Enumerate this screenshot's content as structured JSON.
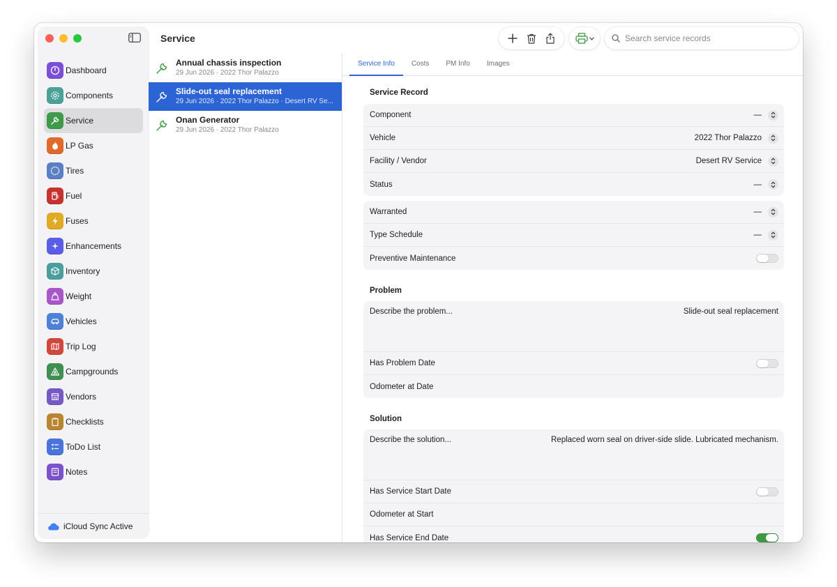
{
  "window": {
    "title": "Service"
  },
  "sidebar": {
    "items": [
      {
        "label": "Dashboard",
        "icon": "gauge-icon",
        "color": "#7b4fd6"
      },
      {
        "label": "Components",
        "icon": "gear-icon",
        "color": "#4aa198"
      },
      {
        "label": "Service",
        "icon": "wrench-icon",
        "color": "#3f9b4a"
      },
      {
        "label": "LP Gas",
        "icon": "flame-icon",
        "color": "#e0692c"
      },
      {
        "label": "Tires",
        "icon": "tire-icon",
        "color": "#5a7fc4"
      },
      {
        "label": "Fuel",
        "icon": "fuel-pump-icon",
        "color": "#c6322e"
      },
      {
        "label": "Fuses",
        "icon": "bolt-icon",
        "color": "#e1aa23"
      },
      {
        "label": "Enhancements",
        "icon": "sparkles-icon",
        "color": "#5a5ee6"
      },
      {
        "label": "Inventory",
        "icon": "box-icon",
        "color": "#4a9f9e"
      },
      {
        "label": "Weight",
        "icon": "scale-icon",
        "color": "#a956c9"
      },
      {
        "label": "Vehicles",
        "icon": "car-icon",
        "color": "#4e80d8"
      },
      {
        "label": "Trip Log",
        "icon": "map-icon",
        "color": "#d2473d"
      },
      {
        "label": "Campgrounds",
        "icon": "tent-icon",
        "color": "#3f9050"
      },
      {
        "label": "Vendors",
        "icon": "storefront-icon",
        "color": "#7658c7"
      },
      {
        "label": "Checklists",
        "icon": "clipboard-icon",
        "color": "#b9862f"
      },
      {
        "label": "ToDo List",
        "icon": "checklist-icon",
        "color": "#4a74d9"
      },
      {
        "label": "Notes",
        "icon": "note-icon",
        "color": "#7b52cc"
      }
    ],
    "active_index": 2,
    "footer": {
      "label": "iCloud Sync Active",
      "icon": "cloud-icon"
    }
  },
  "toolbar": {
    "add": "plus-icon",
    "delete": "trash-icon",
    "share": "share-icon",
    "print": "printer-icon",
    "search_placeholder": "Search service records"
  },
  "records": [
    {
      "title": "Annual chassis inspection",
      "subtitle": "29 Jun 2026 · 2022 Thor Palazzo"
    },
    {
      "title": "Slide-out seal replacement",
      "subtitle": "29 Jun 2026 · 2022 Thor Palazzo · Desert RV Se..."
    },
    {
      "title": "Onan Generator",
      "subtitle": "29 Jun 2026 · 2022 Thor Palazzo"
    }
  ],
  "selected_record": 1,
  "tabs": [
    "Service Info",
    "Costs",
    "PM Info",
    "Images"
  ],
  "active_tab": 0,
  "service_record": {
    "title": "Service Record",
    "component": {
      "label": "Component",
      "value": "—"
    },
    "vehicle": {
      "label": "Vehicle",
      "value": "2022 Thor Palazzo"
    },
    "facility": {
      "label": "Facility / Vendor",
      "value": "Desert RV Service"
    },
    "status": {
      "label": "Status",
      "value": "—"
    },
    "warranted": {
      "label": "Warranted",
      "value": "—"
    },
    "type_schedule": {
      "label": "Type Schedule",
      "value": "—"
    },
    "preventive": {
      "label": "Preventive Maintenance",
      "on": false
    }
  },
  "problem": {
    "title": "Problem",
    "placeholder": "Describe the problem...",
    "value": "Slide-out seal replacement",
    "has_problem_date": {
      "label": "Has Problem Date",
      "on": false
    },
    "odometer": {
      "label": "Odometer at Date"
    }
  },
  "solution": {
    "title": "Solution",
    "placeholder": "Describe the solution...",
    "value": "Replaced worn seal on driver-side slide. Lubricated mechanism.",
    "has_start_date": {
      "label": "Has Service Start Date",
      "on": false
    },
    "odometer_start": {
      "label": "Odometer at Start"
    },
    "has_end_date": {
      "label": "Has Service End Date",
      "on": true
    }
  }
}
